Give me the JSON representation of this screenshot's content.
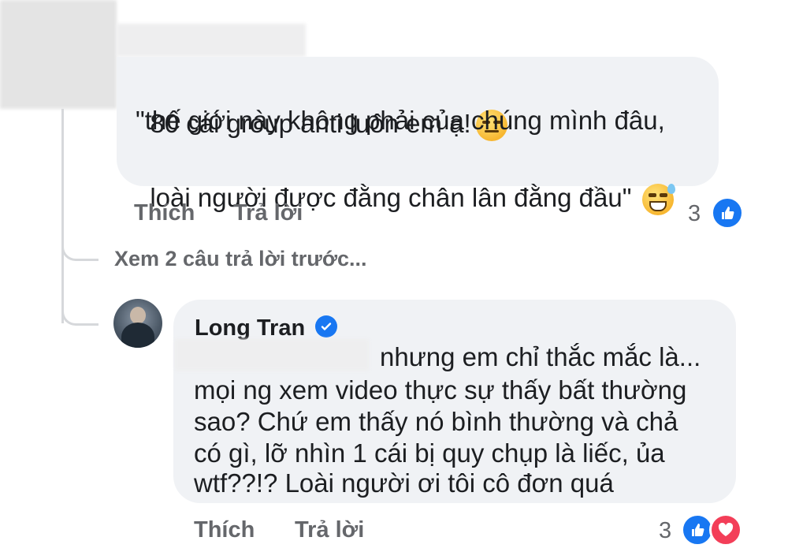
{
  "comment1": {
    "line1": "80 cái group anti luôn em ạ!",
    "line2": "\"thế giới này không phải của chúng mình đâu,",
    "line3": "loài người được đằng chân lân đằng đầu\"",
    "emoji1": "expressionless-face-icon",
    "emoji2": "grinning-sweat-face-icon",
    "like_label": "Thích",
    "reply_label": "Trả lời",
    "reaction_count": "3",
    "reactions": [
      "like-icon"
    ]
  },
  "view_previous": "Xem 2 câu trả lời trước...",
  "comment2": {
    "author": "Long Tran",
    "verified": true,
    "line1": "nhưng em chỉ thắc mắc là...",
    "line2": "mọi ng xem video thực sự thấy bất thường",
    "line3": "sao? Chứ em thấy nó bình thường và chả",
    "line4": "có gì, lỡ nhìn 1 cái bị quy chụp là liếc, ủa",
    "line5": "wtf??!? Loài người ơi tôi cô đơn quá",
    "like_label": "Thích",
    "reply_label": "Trả lời",
    "reaction_count": "3",
    "reactions": [
      "like-icon",
      "love-icon"
    ]
  },
  "colors": {
    "bubble": "#f0f2f5",
    "secondary_text": "#65676b",
    "like_blue": "#1877f2",
    "love_red": "#f33e58"
  }
}
